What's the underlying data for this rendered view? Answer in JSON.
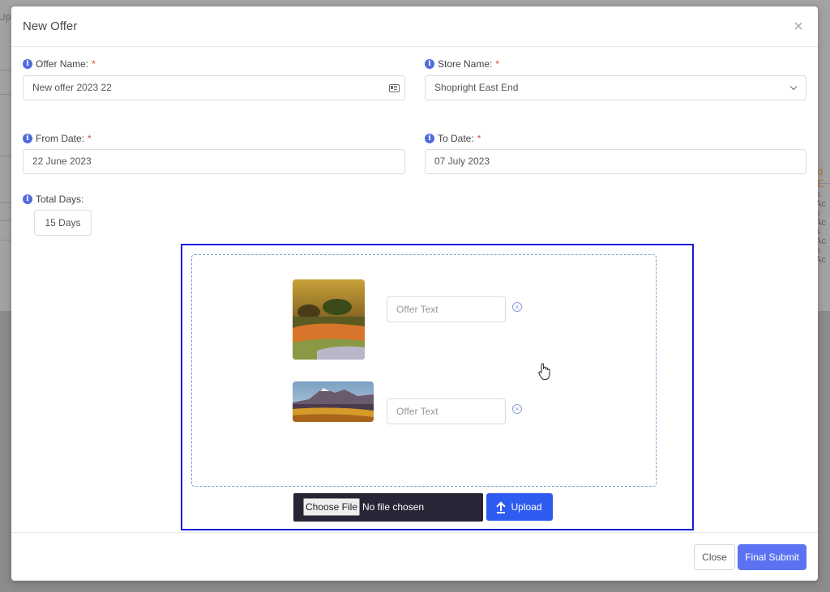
{
  "backdrop": {
    "left_fragment": "Upl",
    "right_header_fragment": "d E",
    "right_cell_fragments": [
      "s Ac",
      "s Ac",
      "s Ac",
      "s Ac"
    ]
  },
  "modal": {
    "title": "New Offer",
    "close_icon": "close-icon"
  },
  "form": {
    "offer_name": {
      "label": "Offer Name:",
      "required_mark": "*",
      "value": "New offer 2023 22"
    },
    "store_name": {
      "label": "Store Name:",
      "required_mark": "*",
      "value": "Shopright East End"
    },
    "from_date": {
      "label": "From Date:",
      "required_mark": "*",
      "value": "22 June 2023"
    },
    "to_date": {
      "label": "To Date:",
      "required_mark": "*",
      "value": "07 July 2023"
    },
    "total_days": {
      "label": "Total Days:",
      "value": "15 Days"
    },
    "info_glyph": "i"
  },
  "upload": {
    "items": [
      {
        "offer_text_placeholder": "Offer Text",
        "thumbnail": "landscape-flowers"
      },
      {
        "offer_text_placeholder": "Offer Text",
        "thumbnail": "landscape-mountain"
      }
    ],
    "remove_glyph": "×",
    "choose_file_label": "Choose File",
    "no_file_text": "No file chosen",
    "upload_label": "Upload"
  },
  "footer": {
    "close_label": "Close",
    "submit_label": "Final Submit"
  },
  "colors": {
    "accent": "#5b73f2",
    "upload_button": "#2f5cf0",
    "frame_border": "#1a1ae0",
    "required": "#e0453c",
    "info": "#4f6bdc"
  }
}
